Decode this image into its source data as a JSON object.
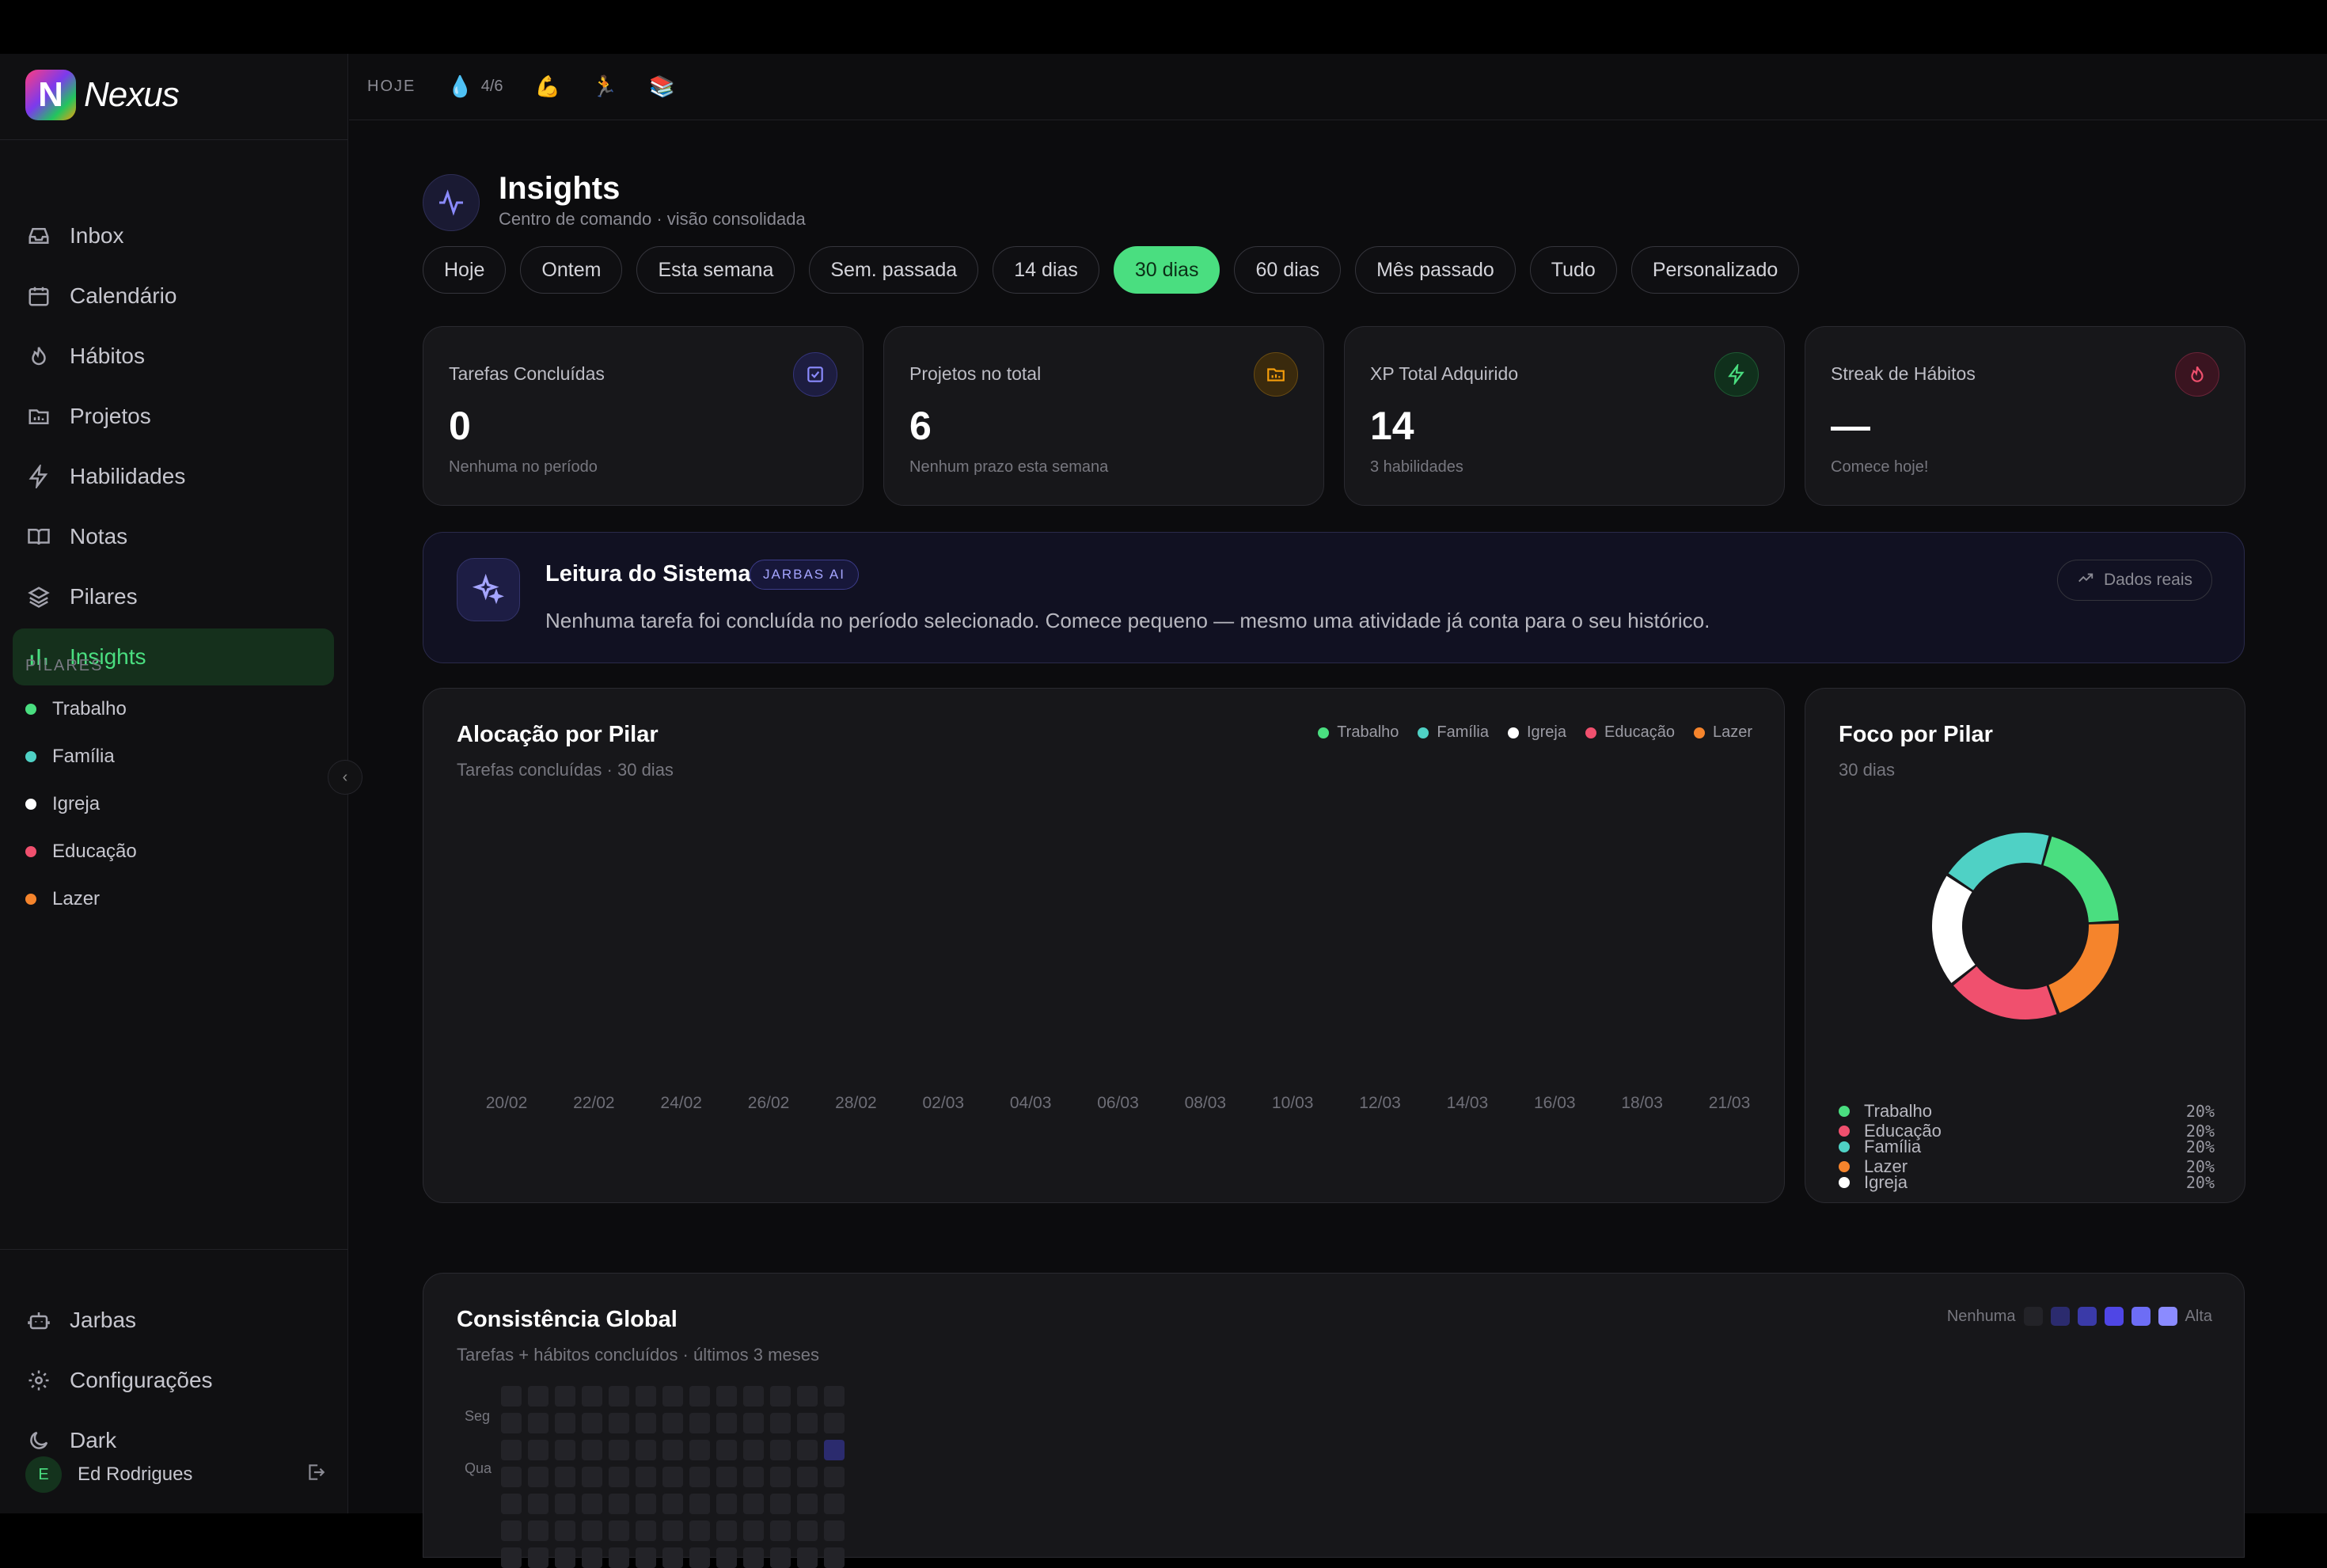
{
  "app": {
    "name": "Nexus"
  },
  "sidebar": {
    "nav": [
      {
        "label": "Inbox",
        "icon": "inbox-icon"
      },
      {
        "label": "Calendário",
        "icon": "calendar-icon"
      },
      {
        "label": "Hábitos",
        "icon": "flame-icon"
      },
      {
        "label": "Projetos",
        "icon": "folder-icon"
      },
      {
        "label": "Habilidades",
        "icon": "bolt-icon"
      },
      {
        "label": "Notas",
        "icon": "book-icon"
      },
      {
        "label": "Pilares",
        "icon": "layers-icon"
      },
      {
        "label": "Insights",
        "icon": "bar-chart-icon"
      }
    ],
    "pilares_title": "PILARES",
    "pilares": [
      {
        "label": "Trabalho",
        "color": "#4ade80"
      },
      {
        "label": "Família",
        "color": "#4fd1c5"
      },
      {
        "label": "Igreja",
        "color": "#ffffff"
      },
      {
        "label": "Educação",
        "color": "#f0506e"
      },
      {
        "label": "Lazer",
        "color": "#f5842c"
      }
    ],
    "bottom": [
      {
        "label": "Jarbas",
        "icon": "bot-icon"
      },
      {
        "label": "Configurações",
        "icon": "gear-icon"
      },
      {
        "label": "Dark",
        "icon": "moon-icon"
      }
    ],
    "user": {
      "initial": "E",
      "name": "Ed Rodrigues"
    }
  },
  "topbar": {
    "today": "HOJE",
    "water": "4/6"
  },
  "page": {
    "title": "Insights",
    "subtitle": "Centro de comando · visão consolidada"
  },
  "filters": {
    "options": [
      "Hoje",
      "Ontem",
      "Esta semana",
      "Sem. passada",
      "14 dias",
      "30 dias",
      "60 dias",
      "Mês passado",
      "Tudo",
      "Personalizado"
    ],
    "selected": "30 dias"
  },
  "stats": [
    {
      "label": "Tarefas Concluídas",
      "value": "0",
      "foot": "Nenhuma no período",
      "icon": "check-square-icon",
      "color": "#7c7cff"
    },
    {
      "label": "Projetos no total",
      "value": "6",
      "foot": "Nenhum prazo esta semana",
      "icon": "folder-icon",
      "color": "#f59e0b"
    },
    {
      "label": "XP Total Adquirido",
      "value": "14",
      "foot": "3 habilidades",
      "icon": "bolt-icon",
      "color": "#4ade80"
    },
    {
      "label": "Streak de Hábitos",
      "value": "—",
      "foot": "Comece hoje!",
      "icon": "flame-icon",
      "color": "#f0506e"
    }
  ],
  "ai": {
    "title": "Leitura do Sistema",
    "badge": "JARBAS AI",
    "text": "Nenhuma tarefa foi concluída no período selecionado. Comece pequeno — mesmo uma atividade já conta para o seu histórico.",
    "button": "Dados reais"
  },
  "allocation": {
    "title": "Alocação por Pilar",
    "subtitle": "Tarefas concluídas · 30 dias",
    "legend": [
      "Trabalho",
      "Família",
      "Igreja",
      "Educação",
      "Lazer"
    ]
  },
  "focus": {
    "title": "Foco por Pilar",
    "subtitle": "30 dias"
  },
  "consistency": {
    "title": "Consistência Global",
    "subtitle": "Tarefas + hábitos concluídos · últimos 3 meses",
    "legend_low": "Nenhuma",
    "legend_high": "Alta",
    "days": [
      "Seg",
      "Qua"
    ]
  },
  "chart_data": [
    {
      "type": "bar",
      "title": "Alocação por Pilar",
      "subtitle": "Tarefas concluídas · 30 dias",
      "categories": [
        "20/02",
        "22/02",
        "24/02",
        "26/02",
        "28/02",
        "02/03",
        "04/03",
        "06/03",
        "08/03",
        "10/03",
        "12/03",
        "14/03",
        "16/03",
        "18/03",
        "21/03"
      ],
      "series": [
        {
          "name": "Trabalho",
          "color": "#4ade80",
          "values": [
            0,
            0,
            0,
            0,
            0,
            0,
            0,
            0,
            0,
            0,
            0,
            0,
            0,
            0,
            0
          ]
        },
        {
          "name": "Família",
          "color": "#4fd1c5",
          "values": [
            0,
            0,
            0,
            0,
            0,
            0,
            0,
            0,
            0,
            0,
            0,
            0,
            0,
            0,
            0
          ]
        },
        {
          "name": "Igreja",
          "color": "#ffffff",
          "values": [
            0,
            0,
            0,
            0,
            0,
            0,
            0,
            0,
            0,
            0,
            0,
            0,
            0,
            0,
            0
          ]
        },
        {
          "name": "Educação",
          "color": "#f0506e",
          "values": [
            0,
            0,
            0,
            0,
            0,
            0,
            0,
            0,
            0,
            0,
            0,
            0,
            0,
            0,
            0
          ]
        },
        {
          "name": "Lazer",
          "color": "#f5842c",
          "values": [
            0,
            0,
            0,
            0,
            0,
            0,
            0,
            0,
            0,
            0,
            0,
            0,
            0,
            0,
            0
          ]
        }
      ],
      "legend": "top-right",
      "grid": false
    },
    {
      "type": "pie",
      "title": "Foco por Pilar",
      "subtitle": "30 dias",
      "slices": [
        {
          "label": "Trabalho",
          "value": 20,
          "display": "20%",
          "color": "#4ade80"
        },
        {
          "label": "Lazer",
          "value": 20,
          "display": "20%",
          "color": "#f5842c"
        },
        {
          "label": "Educação",
          "value": 20,
          "display": "20%",
          "color": "#f0506e"
        },
        {
          "label": "Igreja",
          "value": 20,
          "display": "20%",
          "color": "#ffffff"
        },
        {
          "label": "Família",
          "value": 20,
          "display": "20%",
          "color": "#4fd1c5"
        }
      ],
      "donut": true
    },
    {
      "type": "heatmap",
      "title": "Consistência Global",
      "weeks": 13,
      "active": [
        {
          "week": 12,
          "day": 2,
          "level": 1
        }
      ],
      "scale_colors": [
        "#232328",
        "#2b2b6e",
        "#3a3aa8",
        "#4f46e5",
        "#6d6df5",
        "#8b8bff"
      ]
    }
  ]
}
